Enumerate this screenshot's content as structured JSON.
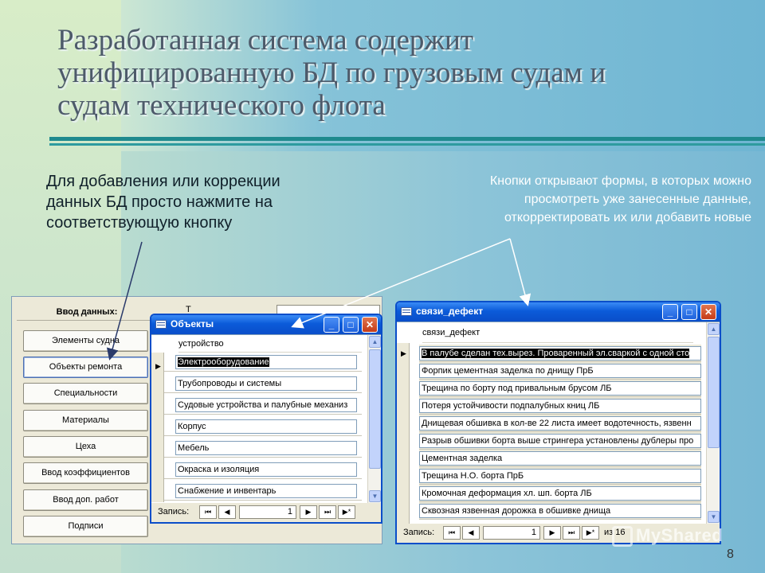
{
  "slide": {
    "title_lines": [
      "Разработанная система содержит",
      "унифицированную БД по грузовым судам и",
      "судам технического флота"
    ],
    "note_left": "Для добавления или коррекции данных БД просто нажмите на соответствующую кнопку",
    "note_right": "Кнопки открывают формы, в которых можно просмотреть уже занесенные данные, откорректировать их или добавить новые",
    "page_number": "8",
    "watermark": "MyShared"
  },
  "switchboard": {
    "header": "Ввод данных:",
    "top_letter": "Т",
    "buttons": [
      "Элементы судна",
      "Объекты ремонта",
      "Специальности",
      "Материалы",
      "Цеха",
      "Ввод коэффициентов",
      "Ввод доп. работ",
      "Подписи"
    ]
  },
  "objects_window": {
    "title": "Объекты",
    "column": "устройство",
    "rows": [
      "Электрооборудование",
      "Трубопроводы и системы",
      "Судовые устройства и палубные механиз",
      "Корпус",
      "Мебель",
      "Окраска и изоляция",
      "Снабжение и инвентарь"
    ],
    "nav": {
      "label": "Запись:",
      "current": "1"
    }
  },
  "defects_window": {
    "title": "связи_дефект",
    "column": "связи_дефект",
    "rows": [
      "В палубе сделан тех.вырез. Проваренный эл.сваркой с одной сто",
      "Форпик цементная заделка по днищу ПрБ",
      "Трещина по борту под привальным брусом ЛБ",
      "Потеря устойчивости подпалубных книц ЛБ",
      "Днищевая обшивка в кол-ве 22 листа имеет водотечность, язвенн",
      "Разрыв обшивки борта выше стрингера установлены дублеры про",
      "Цементная заделка",
      "Трещина Н.О. борта ПрБ",
      "Кромочная деформация хл. шп. борта ЛБ",
      "Сквозная язвенная дорожка в обшивке днища"
    ],
    "nav": {
      "label": "Запись:",
      "current": "1",
      "of": "из 16"
    }
  },
  "icons": {
    "first": "⏮",
    "prev": "◀",
    "next": "▶",
    "last": "⏭",
    "new": "▶*",
    "minimize": "_",
    "maximize": "□",
    "close": "✕",
    "record": "▶",
    "scroll_up": "▲",
    "scroll_down": "▼"
  },
  "colors": {
    "titlebar": "#0a4ec9",
    "accent_rule": "#1f8a8e"
  }
}
